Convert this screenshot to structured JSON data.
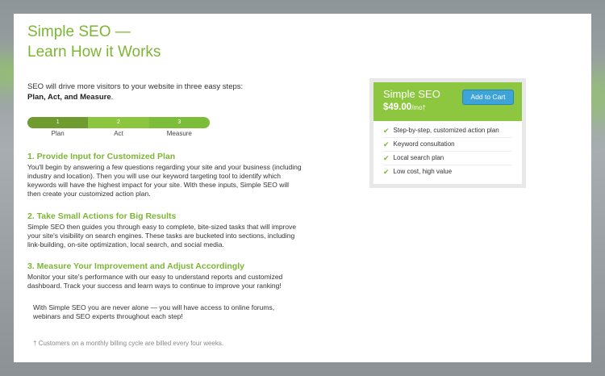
{
  "page": {
    "title_line1": "Simple SEO —",
    "title_line2": "Learn How it Works",
    "intro_text": "SEO will drive more visitors to your website in three easy steps:",
    "intro_bold": "Plan, Act, and Measure",
    "intro_end": "."
  },
  "progress": {
    "steps": [
      {
        "number": "1",
        "label": "Plan"
      },
      {
        "number": "2",
        "label": "Act"
      },
      {
        "number": "3",
        "label": "Measure"
      }
    ]
  },
  "steps": [
    {
      "heading": "1. Provide Input for Customized Plan",
      "body": "You'll begin by answering a few questions regarding your site and your business (including industry and location). Then you will use our keyword targeting tool to identify which keywords will have the highest impact for your site. With these inputs, Simple SEO will then create your customized action plan."
    },
    {
      "heading": "2. Take Small Actions for Big Results",
      "body": "Simple SEO then guides you through easy to complete, bite-sized tasks that will improve your site's visibility on search engines. These tasks are bucketed into sections, including link-building, on-site optimization, local search, and social media."
    },
    {
      "heading": "3. Measure Your Improvement and Adjust Accordingly",
      "body": "Monitor your site's performance with our easy to understand reports and customized dashboard. Track your success and learn ways to continue to improve your ranking!"
    }
  ],
  "alone_text": "With Simple SEO you are never alone — you will have access to online forums, webinars and SEO experts throughout each step!",
  "footnote": "† Customers on a monthly billing cycle are billed every four weeks.",
  "pricing": {
    "product_name": "Simple SEO",
    "price": "$49.00",
    "per": "/mo†",
    "add_to_cart": "Add to Cart",
    "features": [
      "Step-by-step, customized action plan",
      "Keyword consultation",
      "Local search plan",
      "Low cost, high value"
    ],
    "check_icon": "✔"
  },
  "colors": {
    "accent_green": "#7db534",
    "header_green": "#8dc63f",
    "button_blue": "#3ea3d8"
  }
}
